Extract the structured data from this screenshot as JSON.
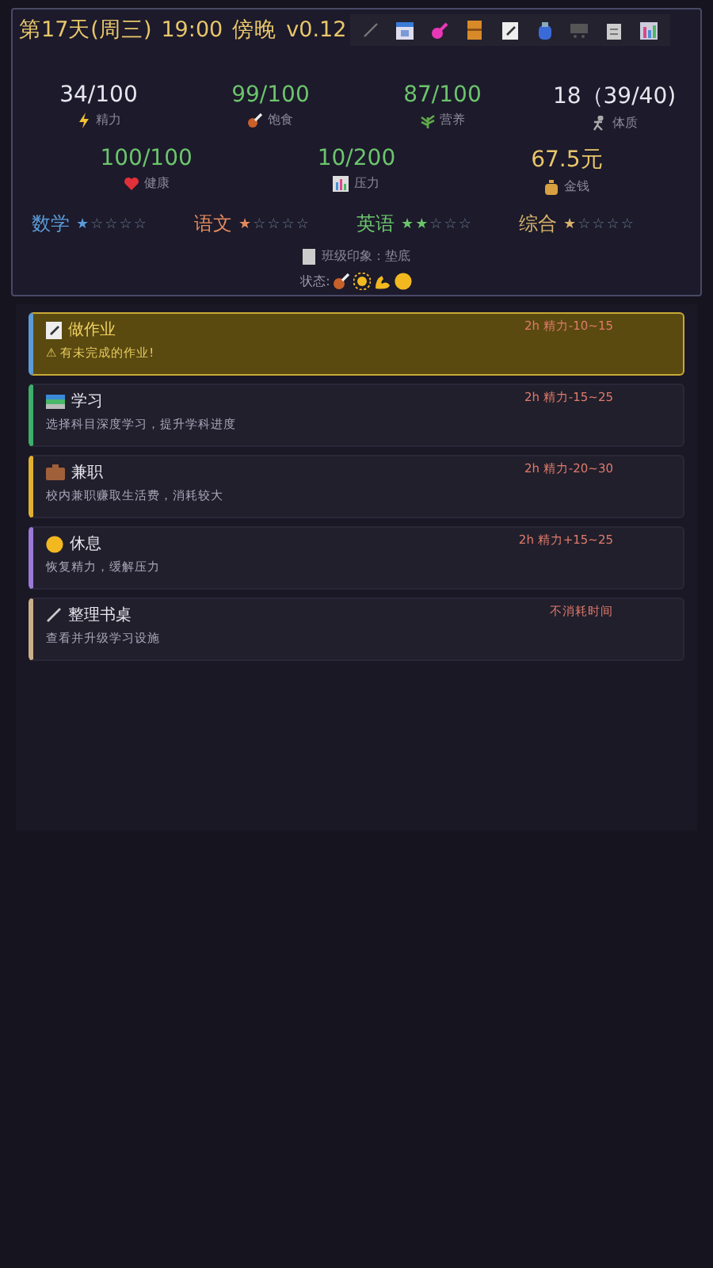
{
  "header": {
    "day": "第17天(周三)",
    "time": "19:00",
    "period": "傍晚",
    "version": "v0.12"
  },
  "stats": [
    {
      "value": "34/100",
      "label": "精力",
      "color": "#e6e6ee"
    },
    {
      "value": "99/100",
      "label": "饱食",
      "color": "#6cc46c"
    },
    {
      "value": "87/100",
      "label": "营养",
      "color": "#6cc46c"
    },
    {
      "value": "18（39/40)",
      "label": "体质",
      "color": "#e6e6ee"
    },
    {
      "value": "100/100",
      "label": "健康",
      "color": "#6cc46c"
    },
    {
      "value": "10/200",
      "label": "压力",
      "color": "#6cc46c"
    },
    {
      "value": "67.5元",
      "label": "金钱",
      "color": "#e8c66a"
    }
  ],
  "subjects": [
    {
      "name": "数学",
      "stars": 1,
      "color": "#5b9bd8"
    },
    {
      "name": "语文",
      "stars": 1,
      "color": "#e38a5c"
    },
    {
      "name": "英语",
      "stars": 2,
      "color": "#6cc46c"
    },
    {
      "name": "综合",
      "stars": 1,
      "color": "#d8b46a"
    }
  ],
  "impression": "班级印象：垫底",
  "status_label": "状态:",
  "activities": [
    {
      "title": "做作业",
      "desc": "⚠ 有未完成的作业!",
      "cost": "2h 精力-10~15",
      "color": "#5b9bd8",
      "selected": true
    },
    {
      "title": "学习",
      "desc": "选择科目深度学习，提升学科进度",
      "cost": "2h 精力-15~25",
      "color": "#3fae6a",
      "selected": false
    },
    {
      "title": "兼职",
      "desc": "校内兼职赚取生活费，消耗较大",
      "cost": "2h 精力-20~30",
      "color": "#e0b030",
      "selected": false
    },
    {
      "title": "休息",
      "desc": "恢复精力，缓解压力",
      "cost": "2h 精力+15~25",
      "color": "#9a7ad8",
      "selected": false
    },
    {
      "title": "整理书桌",
      "desc": "查看并升级学习设施",
      "cost": "不消耗时间",
      "color": "#c8b088",
      "selected": false
    }
  ]
}
